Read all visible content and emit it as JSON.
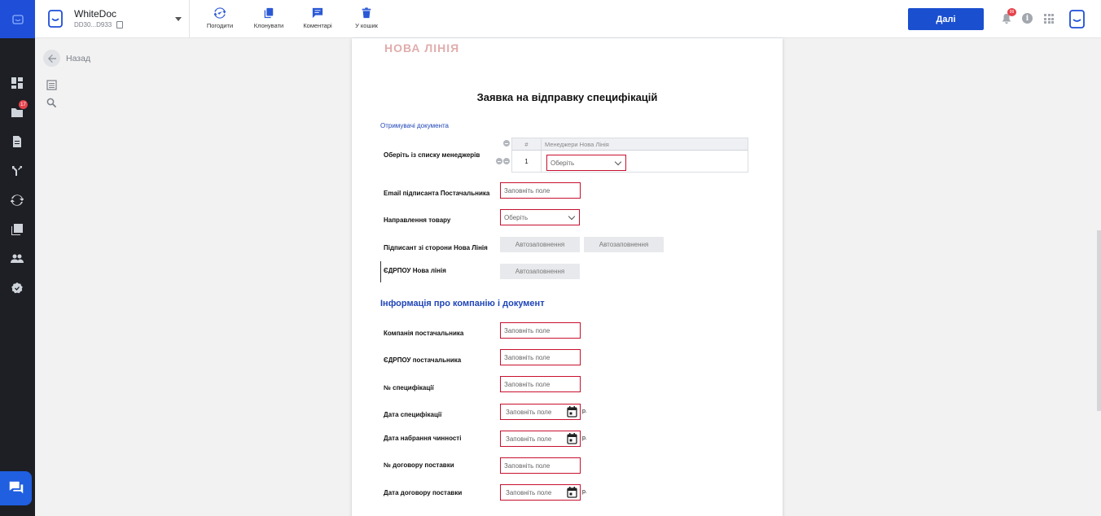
{
  "header": {
    "doc_title": "WhiteDoc",
    "doc_id": "DD30...D933",
    "tools": [
      {
        "label": "Погодити",
        "icon": "sync-check-icon"
      },
      {
        "label": "Клонувати",
        "icon": "clone-icon"
      },
      {
        "label": "Коментарі",
        "icon": "comment-icon"
      },
      {
        "label": "У кошик",
        "icon": "trash-icon"
      }
    ],
    "next_label": "Далі",
    "notifications_count": "99",
    "colors": {
      "accent": "#1a4fcf",
      "rail": "#1d1f24",
      "error_border": "#c8102e"
    }
  },
  "rail": {
    "items": [
      {
        "icon": "dashboard-icon"
      },
      {
        "icon": "folder-icon",
        "badge": "17"
      },
      {
        "icon": "document-icon"
      },
      {
        "icon": "route-icon"
      },
      {
        "icon": "sync-icon"
      },
      {
        "icon": "library-icon"
      },
      {
        "icon": "users-icon"
      },
      {
        "icon": "badge-check-icon"
      }
    ]
  },
  "left_panel": {
    "back_label": "Назад"
  },
  "document": {
    "logo_text": "НОВА ЛІНІЯ",
    "title": "Заявка на відправку специфікацій",
    "section_recipients": "Отримувачі документа",
    "section_company": "Інформація про компанію і документ",
    "managers_label": "Оберіть із списку менеджерів",
    "managers_table": {
      "col_num": "#",
      "col_name": "Менеджери Нова Лінія",
      "rows": [
        {
          "num": "1",
          "value": "Оберіть"
        }
      ]
    },
    "fields": {
      "email_label": "Email підписанта Постачальника",
      "email_placeholder": "Заповніть поле",
      "direction_label": "Направлення товару",
      "direction_value": "Оберіть",
      "signer_label": "Підписант зі сторони Нова Лінія",
      "autofill": "Автозаповнення",
      "edrpou_nl_label": "ЄДРПОУ Нова лінія",
      "company_label": "Компанія постачальника",
      "edrpou_label": "ЄДРПОУ постачальника",
      "spec_no_label": "№ специфікації",
      "spec_date_label": "Дата специфікації",
      "effective_date_label": "Дата набрання чинності",
      "contract_no_label": "№ договору поставки",
      "contract_date_label": "Дата договору поставки",
      "placeholder": "Заповніть поле",
      "year_suffix": "р."
    }
  }
}
